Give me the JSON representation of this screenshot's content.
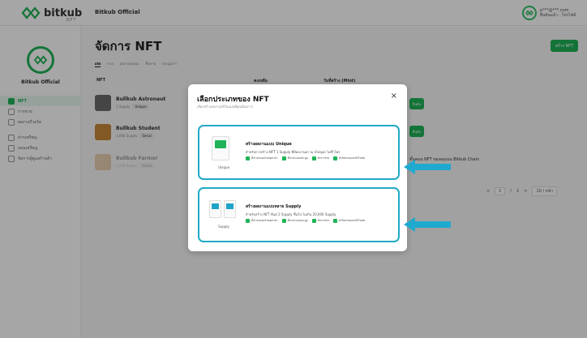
{
  "brand": {
    "name": "bitkub",
    "sub": "NFT"
  },
  "topbar": {
    "title": "Bitkub Official",
    "user_email": "p***@***.com",
    "user_sub": "ยืนยันแล้ว · โปรไฟล์"
  },
  "sidebar": {
    "profile_name": "Bitkub Official",
    "items": [
      {
        "label": "NFT",
        "icon": "nft-icon",
        "active": true
      },
      {
        "label": "การขาย",
        "icon": "tag-icon",
        "active": false
      },
      {
        "label": "ผลงานรีวอร์ด",
        "icon": "gift-icon",
        "active": false
      },
      {
        "label": "ฝากเหรียญ",
        "icon": "deposit-icon",
        "active": false
      },
      {
        "label": "ถอนเหรียญ",
        "icon": "withdraw-icon",
        "active": false
      },
      {
        "label": "จัดการผู้ดูแลร้านค้า",
        "icon": "users-icon",
        "active": false
      }
    ]
  },
  "main": {
    "title": "จัดการ NFT",
    "create_button": "สร้าง NFT",
    "tabs": [
      "ผลิต",
      "ขาย",
      "ผลงานของผม",
      "ซื้อขาย",
      "ประมูลเก้า"
    ],
    "table_headers": [
      "NFT",
      "คงเหลือ",
      "วันที่สร้าง (Mint)"
    ],
    "rows": [
      {
        "name": "Bullkub Astronaut",
        "sub": "1 Supply",
        "tag": "Unique"
      },
      {
        "name": "Bullkub Student",
        "sub": "1,000 Supply",
        "tag": "Serial"
      },
      {
        "name": "Bullkub Farmer",
        "sub": "1,000 Supply",
        "tag": "Serial"
      }
    ],
    "status_chip": "ยืนยัน",
    "side_note": "ขั้นตอน NFT ของคุณบน Bitkub Chain",
    "pager": {
      "prev": "<",
      "page": "1",
      "sep": "/",
      "total": "1",
      "next": ">",
      "per_page": "10 / หน้า"
    }
  },
  "modal": {
    "title": "เลือกประเภทของ NFT",
    "subtitle": "เลือกสร้างผลงานได้ในแบบที่คุณต้องการ",
    "close": "×",
    "cards": [
      {
        "title": "สร้างผลงานแบบ Unique",
        "desc": "สำหรับการสร้าง NFT 1 Supply ที่มีผลงานความ Unique ไม่ซ้ำใคร",
        "label": "Unique",
        "features": [
          "ตั้งราคาแบบกำหนดราคา",
          "ตั้งราคาแบบประมูล",
          "ทำการขาย",
          "ทำกิจกรรมแลกรับรีวอร์ด"
        ]
      },
      {
        "title": "สร้างผลงานแบบหลาย Supply",
        "desc": "สำหรับสร้าง NFT ที่แต่ 2 Supply ขึ้นไป ไม่เกิน 20,000 Supply",
        "label": "Supply",
        "features": [
          "ตั้งราคาแบบกำหนดราคา",
          "ตั้งราคาแบบประมูล",
          "ทำการขาย",
          "ทำกิจกรรมแลกรับรีวอร์ด"
        ]
      }
    ]
  },
  "colors": {
    "accent": "#20b357",
    "highlight": "#21a9c4"
  }
}
